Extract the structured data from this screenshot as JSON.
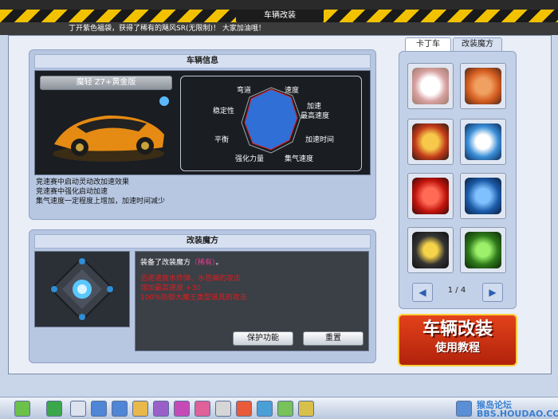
{
  "window": {
    "title": "车辆改装"
  },
  "broadcast": "丁开紫色福袋，获得了稀有的飓风SR(无限制)！ 大家加油哦！",
  "car_info": {
    "header": "车辆信息",
    "car_name": "魔轻  Z7+黄金版",
    "radar_labels": [
      "弯道",
      "速度",
      "加速",
      "最高速度",
      "加速时间",
      "集气速度",
      "强化力量",
      "平衡",
      "稳定性"
    ],
    "description": [
      "竞速赛中启动灵动改加速效果",
      "竞速赛中强化启动加速",
      "集气速度一定程度上增加，加速时间减少"
    ]
  },
  "magic": {
    "header": "改装魔方",
    "equipped_prefix": "装备了改装魔方",
    "equipped_name": "（稀有）",
    "equipped_suffix": "。",
    "effects": [
      "迅速速度水炸弹、水苍蝇的攻击",
      "增加最高速度 +30",
      "100%防御大魔王类型道具的攻击"
    ],
    "protect_button": "保护功能",
    "reset_button": "重置"
  },
  "tabs": [
    "卡丁车",
    "改装魔方"
  ],
  "pager": {
    "page": "1 / 4"
  },
  "tutorial": {
    "line1": "车辆改装",
    "line2": "使用教程"
  },
  "watermark": "猴岛论坛 BBS.HOUDAO.COM",
  "colors": {
    "accent": "#f2c200",
    "effect_red": "#e21b1b",
    "rare": "#e83b8f",
    "radar_fill": "#2f6fd6"
  }
}
